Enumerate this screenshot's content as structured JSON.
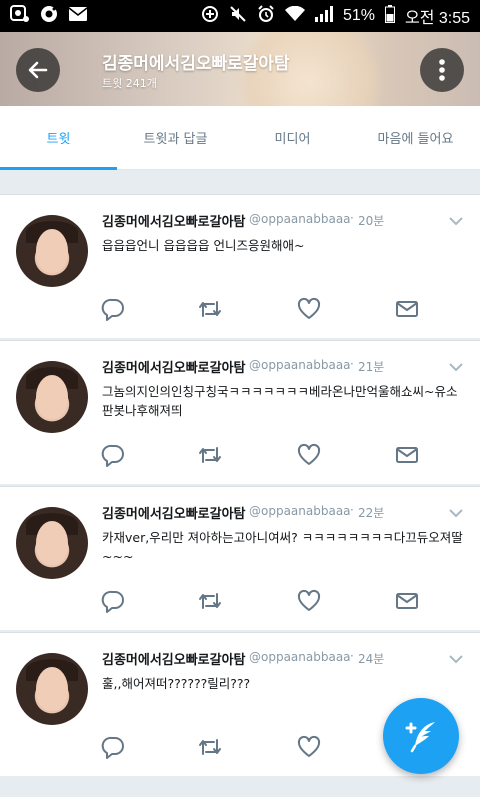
{
  "status_bar": {
    "battery": "51%",
    "time": "오전 3:55"
  },
  "header": {
    "title": "김종머에서김오빠로갈아탐",
    "subtitle": "트윗 241개"
  },
  "tabs": [
    {
      "label": "트윗",
      "active": true
    },
    {
      "label": "트윗과 답글",
      "active": false
    },
    {
      "label": "미디어",
      "active": false
    },
    {
      "label": "마음에 들어요",
      "active": false
    }
  ],
  "tweets": [
    {
      "name": "김종머에서김오빠로갈아탐",
      "handle": "@oppaanabbaaa",
      "dot": "·",
      "time": "20분",
      "text": "읍읍읍언니 읍읍읍읍 언니즈응원해애~"
    },
    {
      "name": "김종머에서김오빠로갈아탐",
      "handle": "@oppaanabbaaa",
      "dot": "·",
      "time": "21분",
      "text": "그놈의지인의인칭구칭국ㅋㅋㅋㅋㅋㅋㅋ베라온나만억울해쇼씨~유소판봇나후해져띄"
    },
    {
      "name": "김종머에서김오빠로갈아탐",
      "handle": "@oppaanabbaaa",
      "dot": "·",
      "time": "22분",
      "text": "카재ver,우리만 져아하는고아니여써? ㅋㅋㅋㅋㅋㅋㅋㅋ다끄듀오져딸~~~"
    },
    {
      "name": "김종머에서김오빠로갈아탐",
      "handle": "@oppaanabbaaa",
      "dot": "·",
      "time": "24분",
      "text": "훌,,해어져떠??????릴리???"
    }
  ],
  "colors": {
    "accent": "#1da1f2",
    "muted": "#8899a6",
    "text": "#14171a"
  }
}
